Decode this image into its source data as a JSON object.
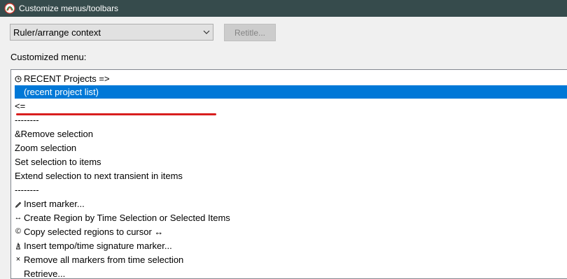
{
  "window": {
    "title": "Customize menus/toolbars"
  },
  "context_select": {
    "value": "Ruler/arrange context"
  },
  "retitle_button": {
    "label": "Retitle..."
  },
  "customized_menu": {
    "label": "Customized menu:",
    "items": [
      {
        "icon": "clock-icon",
        "text": "RECENT Projects =>"
      },
      {
        "icon": "",
        "text": "(recent project list)",
        "selected": true
      },
      {
        "icon": "",
        "text": "<="
      },
      {
        "icon": "",
        "text": "--------"
      },
      {
        "icon": "",
        "text": "&Remove selection"
      },
      {
        "icon": "",
        "text": "Zoom selection"
      },
      {
        "icon": "",
        "text": "Set selection to items"
      },
      {
        "icon": "",
        "text": "Extend selection to next transient in items"
      },
      {
        "icon": "",
        "text": "--------"
      },
      {
        "icon": "pencil-icon",
        "text": "Insert marker..."
      },
      {
        "icon": "double-arrow-icon",
        "text": "Create Region by Time Selection or Selected Items"
      },
      {
        "icon": "copyright-icon",
        "text": "Copy selected regions to cursor ↔"
      },
      {
        "icon": "metronome-icon",
        "text": "Insert tempo/time signature marker..."
      },
      {
        "icon": "cross-icon",
        "text": "Remove all markers from time selection"
      },
      {
        "icon": "",
        "text": "Retrieve..."
      }
    ]
  },
  "colors": {
    "titlebar": "#364b4c",
    "selection": "#0078d7",
    "annotation_underline": "#d81e1e"
  }
}
